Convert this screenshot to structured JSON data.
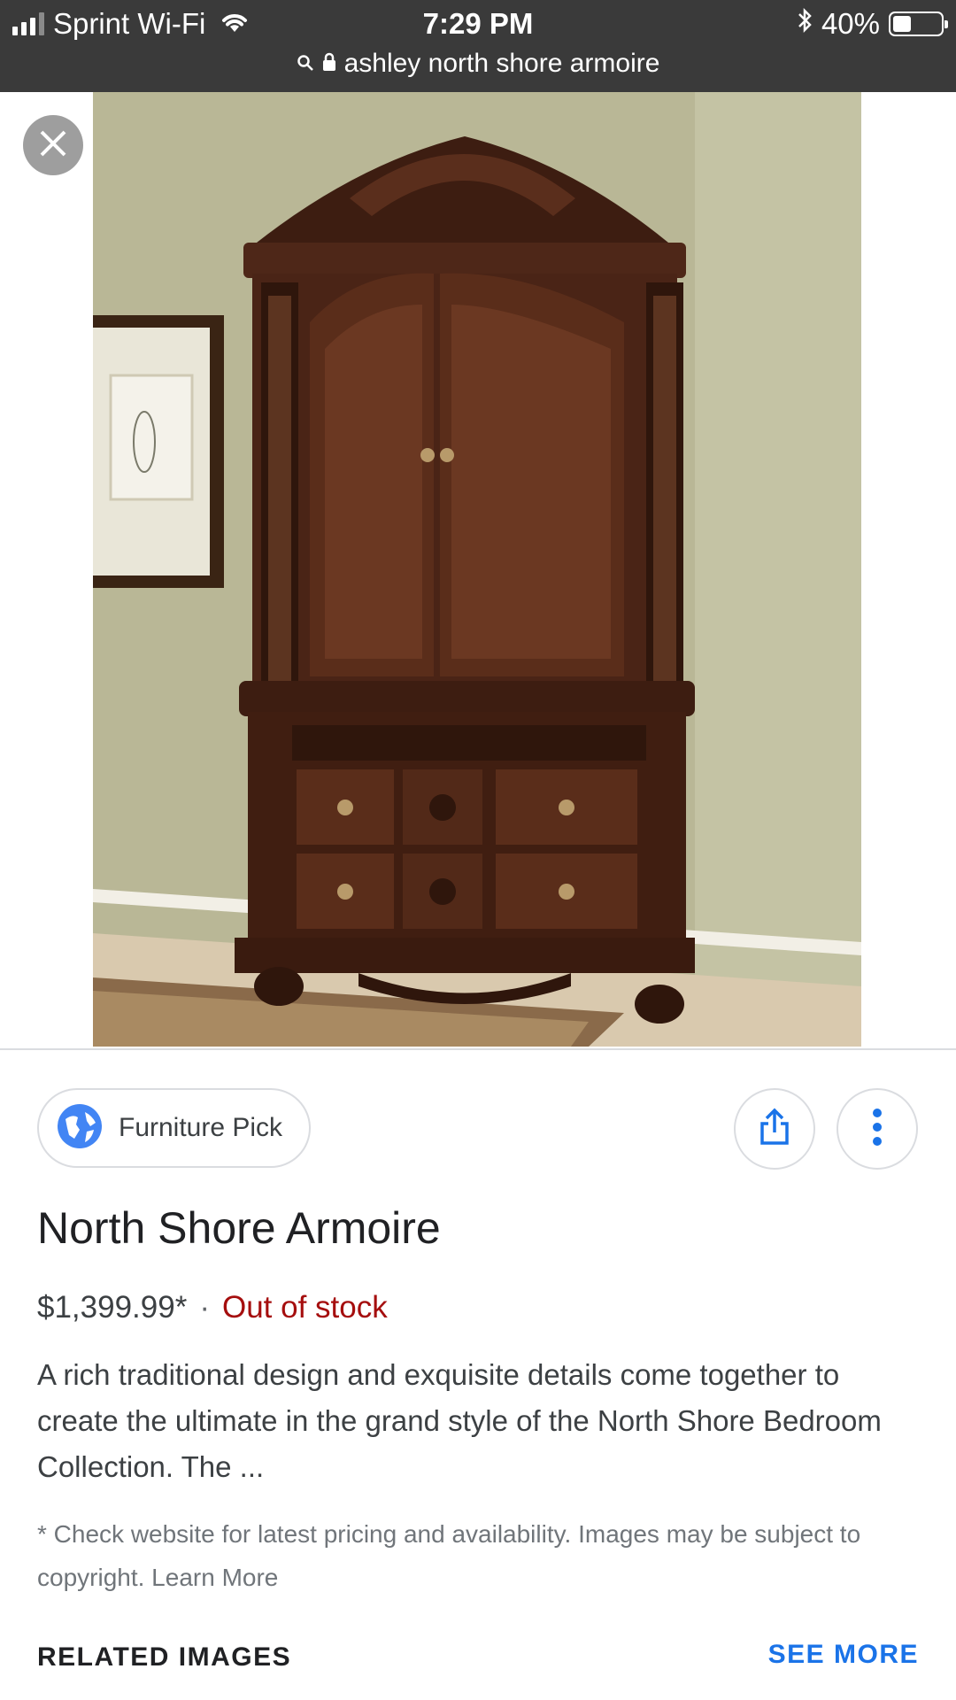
{
  "status_bar": {
    "carrier": "Sprint Wi-Fi",
    "time": "7:29 PM",
    "battery": "40%",
    "battery_level": 0.4,
    "url": "ashley north shore armoire"
  },
  "viewer": {
    "close_icon": "close-icon"
  },
  "source": {
    "name": "Furniture Pick",
    "icon": "globe-icon"
  },
  "actions": {
    "share_icon": "share-icon",
    "more_icon": "more-vert-icon"
  },
  "product": {
    "title": "North Shore Armoire",
    "price": "$1,399.99*",
    "separator": "·",
    "availability": "Out of stock",
    "description": "A rich traditional design and exquisite details come together to create the ultimate in the grand style of the North Shore Bedroom Collection. The ..."
  },
  "disclaimer": "* Check website for latest pricing and availability. Images may be subject to copyright. Learn More",
  "related": {
    "heading": "RELATED IMAGES",
    "see_more": "SEE MORE"
  },
  "colors": {
    "status_bar": "#3a3a3a",
    "out_of_stock": "#a50e0e",
    "link": "#1a73e8",
    "wall": "#b9b796",
    "wood": "#4a2416"
  }
}
